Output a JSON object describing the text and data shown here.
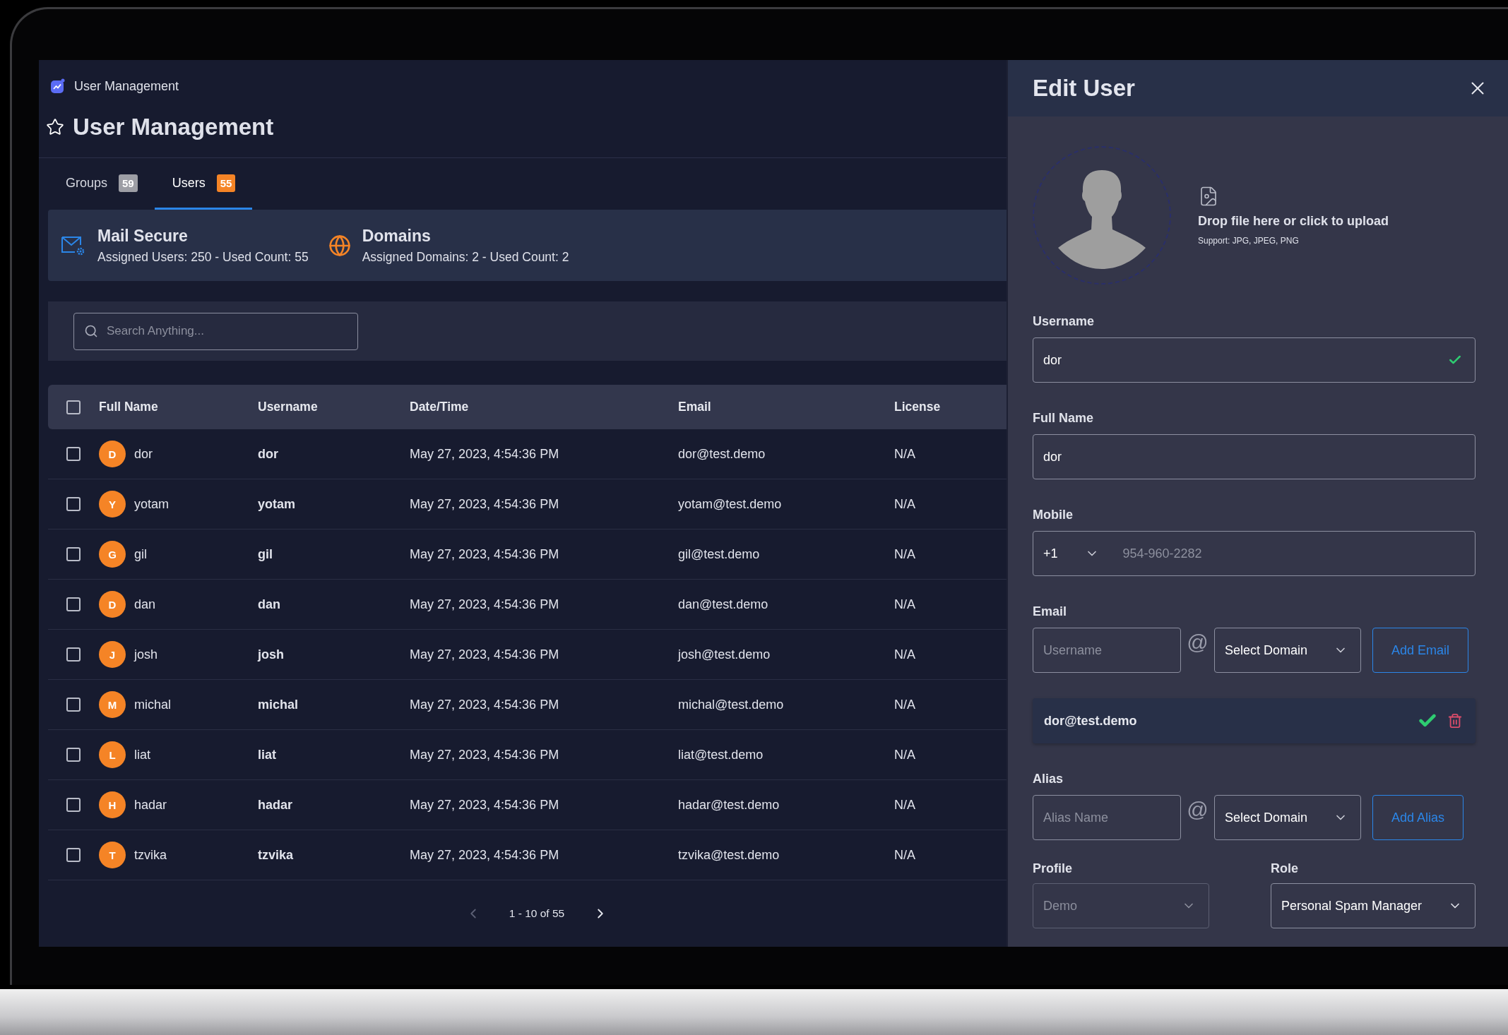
{
  "breadcrumb": {
    "title": "User Management"
  },
  "page_title": "User Management",
  "tabs": [
    {
      "label": "Groups",
      "count": "59",
      "selected": false
    },
    {
      "label": "Users",
      "count": "55",
      "selected": true
    }
  ],
  "info_cards": [
    {
      "kind": "mail",
      "title": "Mail Secure",
      "subtitle": "Assigned Users: 250 - Used Count: 55"
    },
    {
      "kind": "domains",
      "title": "Domains",
      "subtitle": "Assigned Domains: 2 - Used Count: 2"
    }
  ],
  "search": {
    "placeholder": "Search Anything..."
  },
  "table": {
    "all_checked": false,
    "columns": [
      "Full Name",
      "Username",
      "Date/Time",
      "Email",
      "License"
    ],
    "rows": [
      {
        "initial": "D",
        "full_name": "dor",
        "username": "dor",
        "datetime": "May 27, 2023, 4:54:36 PM",
        "email": "dor@test.demo",
        "license": "N/A",
        "checked": false
      },
      {
        "initial": "Y",
        "full_name": "yotam",
        "username": "yotam",
        "datetime": "May 27, 2023, 4:54:36 PM",
        "email": "yotam@test.demo",
        "license": "N/A",
        "checked": false
      },
      {
        "initial": "G",
        "full_name": "gil",
        "username": "gil",
        "datetime": "May 27, 2023, 4:54:36 PM",
        "email": "gil@test.demo",
        "license": "N/A",
        "checked": false
      },
      {
        "initial": "D",
        "full_name": "dan",
        "username": "dan",
        "datetime": "May 27, 2023, 4:54:36 PM",
        "email": "dan@test.demo",
        "license": "N/A",
        "checked": false
      },
      {
        "initial": "J",
        "full_name": "josh",
        "username": "josh",
        "datetime": "May 27, 2023, 4:54:36 PM",
        "email": "josh@test.demo",
        "license": "N/A",
        "checked": false
      },
      {
        "initial": "M",
        "full_name": "michal",
        "username": "michal",
        "datetime": "May 27, 2023, 4:54:36 PM",
        "email": "michal@test.demo",
        "license": "N/A",
        "checked": false
      },
      {
        "initial": "L",
        "full_name": "liat",
        "username": "liat",
        "datetime": "May 27, 2023, 4:54:36 PM",
        "email": "liat@test.demo",
        "license": "N/A",
        "checked": false
      },
      {
        "initial": "H",
        "full_name": "hadar",
        "username": "hadar",
        "datetime": "May 27, 2023, 4:54:36 PM",
        "email": "hadar@test.demo",
        "license": "N/A",
        "checked": false
      },
      {
        "initial": "T",
        "full_name": "tzvika",
        "username": "tzvika",
        "datetime": "May 27, 2023, 4:54:36 PM",
        "email": "tzvika@test.demo",
        "license": "N/A",
        "checked": false
      }
    ]
  },
  "pagination": {
    "range": "1 - 10 of 55"
  },
  "edit_panel": {
    "title": "Edit User",
    "upload": {
      "prompt": "Drop file here or click to upload",
      "support": "Support: JPG, JPEG, PNG"
    },
    "username": {
      "label": "Username",
      "value": "dor",
      "valid": true
    },
    "full_name": {
      "label": "Full Name",
      "value": "dor"
    },
    "mobile": {
      "label": "Mobile",
      "country_code": "+1",
      "placeholder": "954-960-2282"
    },
    "email": {
      "label": "Email",
      "placeholder": "Username",
      "at_sign": "@",
      "domain": "Select Domain",
      "button": "Add Email",
      "items": [
        {
          "address": "dor@test.demo",
          "verified": true
        }
      ]
    },
    "alias": {
      "label": "Alias",
      "placeholder": "Alias Name",
      "at_sign": "@",
      "domain": "Select Domain",
      "button": "Add Alias"
    },
    "profile": {
      "label": "Profile",
      "value": "Demo",
      "disabled": true
    },
    "role": {
      "label": "Role",
      "value": "Personal Spam Manager",
      "disabled": false
    }
  }
}
